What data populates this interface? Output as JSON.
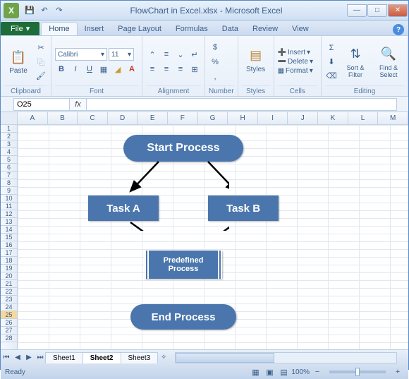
{
  "window": {
    "title": "FlowChart in Excel.xlsx - Microsoft Excel",
    "app_glyph": "X"
  },
  "tabs": {
    "file": "File",
    "list": [
      "Home",
      "Insert",
      "Page Layout",
      "Formulas",
      "Data",
      "Review",
      "View"
    ],
    "active": "Home"
  },
  "ribbon": {
    "clipboard": {
      "label": "Clipboard",
      "paste": "Paste"
    },
    "font": {
      "label": "Font",
      "name": "Calibri",
      "size": "11"
    },
    "alignment": {
      "label": "Alignment"
    },
    "number": {
      "label": "Number"
    },
    "styles": {
      "label": "Styles",
      "btn": "Styles"
    },
    "cells": {
      "label": "Cells",
      "insert": "Insert",
      "delete": "Delete",
      "format": "Format"
    },
    "editing": {
      "label": "Editing",
      "sort": "Sort & Filter",
      "find": "Find & Select"
    }
  },
  "namebox": "O25",
  "columns": [
    "A",
    "B",
    "C",
    "D",
    "E",
    "F",
    "G",
    "H",
    "I",
    "J",
    "K",
    "L",
    "M"
  ],
  "rows": [
    "1",
    "2",
    "3",
    "4",
    "5",
    "6",
    "7",
    "8",
    "9",
    "10",
    "11",
    "12",
    "13",
    "14",
    "15",
    "16",
    "17",
    "18",
    "19",
    "20",
    "21",
    "22",
    "23",
    "24",
    "25",
    "26",
    "27",
    "28"
  ],
  "active_row": "25",
  "flowchart": {
    "start": "Start Process",
    "task_a": "Task A",
    "task_b": "Task B",
    "predefined": "Predefined Process",
    "end": "End Process"
  },
  "sheets": {
    "list": [
      "Sheet1",
      "Sheet2",
      "Sheet3"
    ],
    "active": "Sheet2"
  },
  "status": {
    "ready": "Ready",
    "zoom": "100%"
  }
}
